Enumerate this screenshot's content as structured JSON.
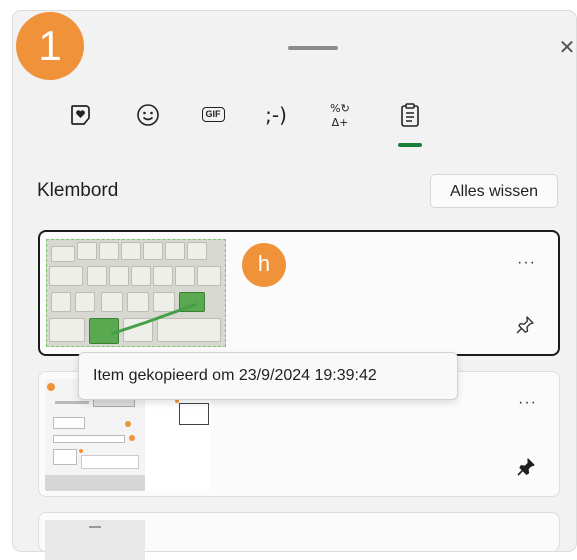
{
  "badge": {
    "step": "1",
    "item_marker": "h"
  },
  "header": {
    "close": "✕"
  },
  "tabs": [
    {
      "name": "favorites",
      "icon": "heart-sticker-icon"
    },
    {
      "name": "emoji",
      "icon": "smiley-icon",
      "glyph": "☺"
    },
    {
      "name": "gif",
      "icon": "gif-icon",
      "glyph": "GIF"
    },
    {
      "name": "kaomoji",
      "icon": "kaomoji-icon",
      "glyph": ";-)"
    },
    {
      "name": "symbols",
      "icon": "symbols-icon",
      "glyph_top": "%↻",
      "glyph_bottom": "Δ+"
    },
    {
      "name": "clipboard",
      "icon": "clipboard-icon",
      "active": true
    }
  ],
  "clipboard": {
    "title": "Klembord",
    "clear_all": "Alles wissen",
    "items": [
      {
        "type": "image",
        "thumb": "keyboard-photo",
        "pinned": false,
        "more": "···"
      },
      {
        "type": "image",
        "thumb": "screenshot",
        "pinned": true,
        "more": "···"
      }
    ],
    "tooltip": "Item gekopieerd om 23/9/2024 19:39:42"
  },
  "colors": {
    "accent_green": "#1a7f37",
    "badge_orange": "#f0923a"
  }
}
